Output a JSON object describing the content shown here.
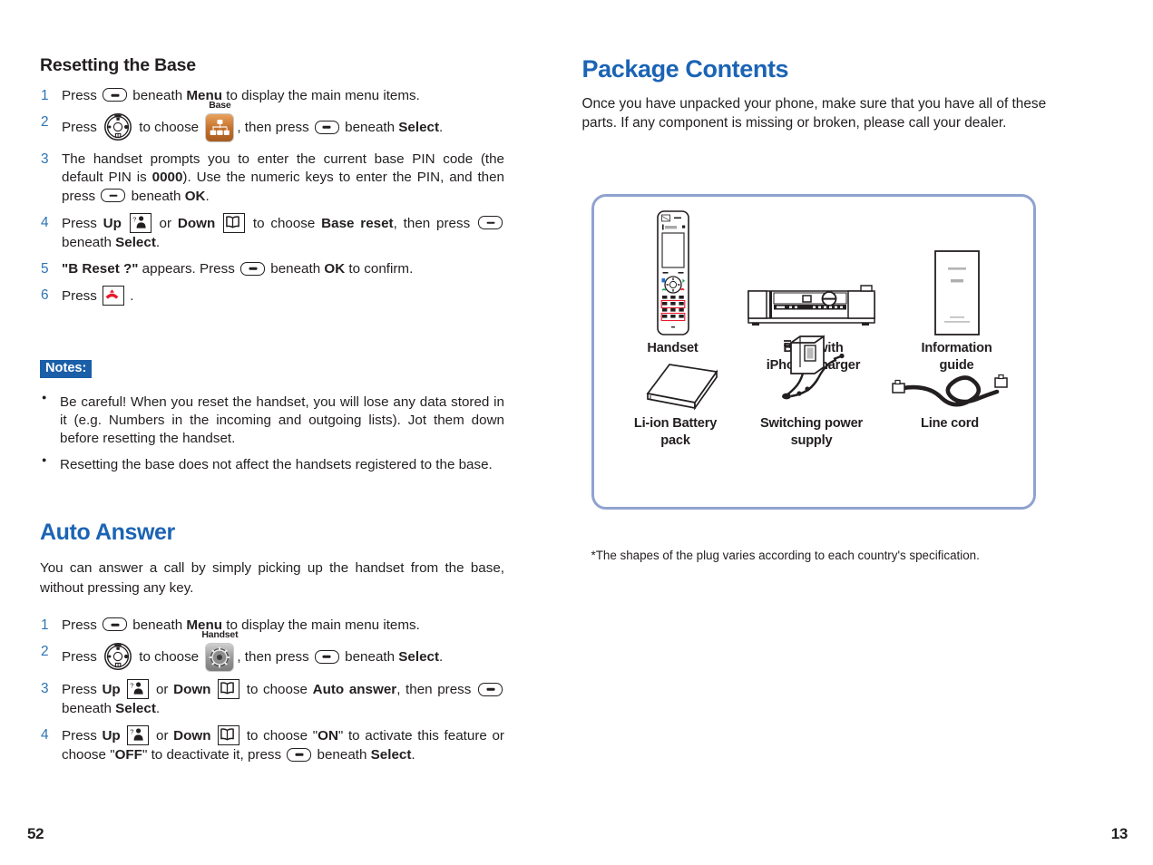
{
  "left_page": {
    "page_number": "52",
    "section1": {
      "heading": "Resetting the Base",
      "steps": [
        {
          "num": "1",
          "parts": [
            {
              "t": "text",
              "v": "Press "
            },
            {
              "t": "icon",
              "v": "softkey-icon"
            },
            {
              "t": "text",
              "v": " beneath "
            },
            {
              "t": "bold",
              "v": "Menu"
            },
            {
              "t": "text",
              "v": " to display the main menu items."
            }
          ]
        },
        {
          "num": "2",
          "parts": [
            {
              "t": "text",
              "v": "Press "
            },
            {
              "t": "icon",
              "v": "nav-wheel-icon"
            },
            {
              "t": "text",
              "v": " to choose "
            },
            {
              "t": "icon",
              "v": "base-menu-tile-icon",
              "caption": "Base"
            },
            {
              "t": "text",
              "v": ", then press "
            },
            {
              "t": "icon",
              "v": "softkey-icon"
            },
            {
              "t": "text",
              "v": " beneath "
            },
            {
              "t": "bold",
              "v": "Select"
            },
            {
              "t": "text",
              "v": "."
            }
          ]
        },
        {
          "num": "3",
          "parts": [
            {
              "t": "text",
              "v": "The handset prompts you to enter the current base PIN code (the default PIN is "
            },
            {
              "t": "bold",
              "v": "0000"
            },
            {
              "t": "text",
              "v": "). Use the numeric keys to enter the PIN, and then press "
            },
            {
              "t": "icon",
              "v": "softkey-icon"
            },
            {
              "t": "text",
              "v": " beneath "
            },
            {
              "t": "bold",
              "v": "OK"
            },
            {
              "t": "text",
              "v": "."
            }
          ]
        },
        {
          "num": "4",
          "parts": [
            {
              "t": "text",
              "v": "Press "
            },
            {
              "t": "bold",
              "v": "Up"
            },
            {
              "t": "text",
              "v": " "
            },
            {
              "t": "icon",
              "v": "up-key-icon"
            },
            {
              "t": "text",
              "v": " or "
            },
            {
              "t": "bold",
              "v": "Down"
            },
            {
              "t": "text",
              "v": " "
            },
            {
              "t": "icon",
              "v": "down-key-icon"
            },
            {
              "t": "text",
              "v": " to choose "
            },
            {
              "t": "bold",
              "v": "Base reset"
            },
            {
              "t": "text",
              "v": ", then press "
            },
            {
              "t": "icon",
              "v": "softkey-icon"
            },
            {
              "t": "text",
              "v": " beneath "
            },
            {
              "t": "bold",
              "v": "Select"
            },
            {
              "t": "text",
              "v": "."
            }
          ]
        },
        {
          "num": "5",
          "parts": [
            {
              "t": "bold",
              "v": "\"B Reset ?\""
            },
            {
              "t": "text",
              "v": " appears. Press "
            },
            {
              "t": "icon",
              "v": "softkey-icon"
            },
            {
              "t": "text",
              "v": " beneath "
            },
            {
              "t": "bold",
              "v": "OK"
            },
            {
              "t": "text",
              "v": " to confirm."
            }
          ]
        },
        {
          "num": "6",
          "parts": [
            {
              "t": "text",
              "v": "Press "
            },
            {
              "t": "icon",
              "v": "hangup-key-icon"
            },
            {
              "t": "text",
              "v": " ."
            }
          ]
        }
      ],
      "notes_label": "Notes:",
      "notes": [
        "Be careful! When you reset the handset, you will lose any data stored in it (e.g. Numbers in the incoming and outgoing lists). Jot them down before resetting the handset.",
        "Resetting the base does not affect the handsets registered to the base."
      ]
    },
    "section2": {
      "heading": "Auto Answer",
      "intro": "You can answer a call by simply picking up the handset from the base, without pressing any key.",
      "steps": [
        {
          "num": "1",
          "parts": [
            {
              "t": "text",
              "v": "Press "
            },
            {
              "t": "icon",
              "v": "softkey-icon"
            },
            {
              "t": "text",
              "v": " beneath "
            },
            {
              "t": "bold",
              "v": "Menu"
            },
            {
              "t": "text",
              "v": " to display the main menu items."
            }
          ]
        },
        {
          "num": "2",
          "parts": [
            {
              "t": "text",
              "v": "Press "
            },
            {
              "t": "icon",
              "v": "nav-wheel-icon"
            },
            {
              "t": "text",
              "v": " to choose "
            },
            {
              "t": "icon",
              "v": "handset-menu-tile-icon",
              "caption": "Handset"
            },
            {
              "t": "text",
              "v": ", then press "
            },
            {
              "t": "icon",
              "v": "softkey-icon"
            },
            {
              "t": "text",
              "v": " beneath "
            },
            {
              "t": "bold",
              "v": "Select"
            },
            {
              "t": "text",
              "v": "."
            }
          ]
        },
        {
          "num": "3",
          "parts": [
            {
              "t": "text",
              "v": "Press "
            },
            {
              "t": "bold",
              "v": "Up"
            },
            {
              "t": "text",
              "v": " "
            },
            {
              "t": "icon",
              "v": "up-key-icon"
            },
            {
              "t": "text",
              "v": " or "
            },
            {
              "t": "bold",
              "v": "Down"
            },
            {
              "t": "text",
              "v": " "
            },
            {
              "t": "icon",
              "v": "down-key-icon"
            },
            {
              "t": "text",
              "v": " to choose "
            },
            {
              "t": "bold",
              "v": "Auto answer"
            },
            {
              "t": "text",
              "v": ", then press "
            },
            {
              "t": "icon",
              "v": "softkey-icon"
            },
            {
              "t": "text",
              "v": " beneath "
            },
            {
              "t": "bold",
              "v": "Select"
            },
            {
              "t": "text",
              "v": "."
            }
          ]
        },
        {
          "num": "4",
          "parts": [
            {
              "t": "text",
              "v": "Press "
            },
            {
              "t": "bold",
              "v": "Up"
            },
            {
              "t": "text",
              "v": " "
            },
            {
              "t": "icon",
              "v": "up-key-icon"
            },
            {
              "t": "text",
              "v": " or "
            },
            {
              "t": "bold",
              "v": "Down"
            },
            {
              "t": "text",
              "v": " "
            },
            {
              "t": "icon",
              "v": "down-key-icon"
            },
            {
              "t": "text",
              "v": " to choose \""
            },
            {
              "t": "bold",
              "v": "ON"
            },
            {
              "t": "text",
              "v": "\" to activate this feature or choose \""
            },
            {
              "t": "bold",
              "v": "OFF"
            },
            {
              "t": "text",
              "v": "\" to deactivate it, press "
            },
            {
              "t": "icon",
              "v": "softkey-icon"
            },
            {
              "t": "text",
              "v": " beneath "
            },
            {
              "t": "bold",
              "v": "Select"
            },
            {
              "t": "text",
              "v": "."
            }
          ]
        }
      ]
    }
  },
  "right_page": {
    "page_number": "13",
    "heading": "Package Contents",
    "intro": "Once you have unpacked your phone, make sure that you have all of these parts. If any component is missing or broken, please call your dealer.",
    "package_items": [
      {
        "id": "handset",
        "caption": "Handset",
        "art": "handset-illustration"
      },
      {
        "id": "base",
        "caption": "Base with\niPhone charger",
        "art": "base-illustration"
      },
      {
        "id": "info-guide",
        "caption": "Information\nguide",
        "art": "booklet-illustration"
      },
      {
        "id": "battery",
        "caption": "Li-ion Battery\npack",
        "art": "battery-illustration"
      },
      {
        "id": "power-supply",
        "caption": "Switching power\nsupply",
        "art": "power-supply-illustration"
      },
      {
        "id": "line-cord",
        "caption": "Line cord",
        "art": "line-cord-illustration"
      }
    ],
    "footnote": "*The shapes of the plug varies according to each country's specification."
  },
  "colors": {
    "heading_blue": "#1b64b4",
    "step_number_blue": "#2e74b5",
    "notes_badge_blue": "#1a5fa8",
    "box_border": "#8fa3cf",
    "base_tile_orange": "#c4712c",
    "hangup_red": "#e8192c",
    "body_text": "#231f20"
  }
}
